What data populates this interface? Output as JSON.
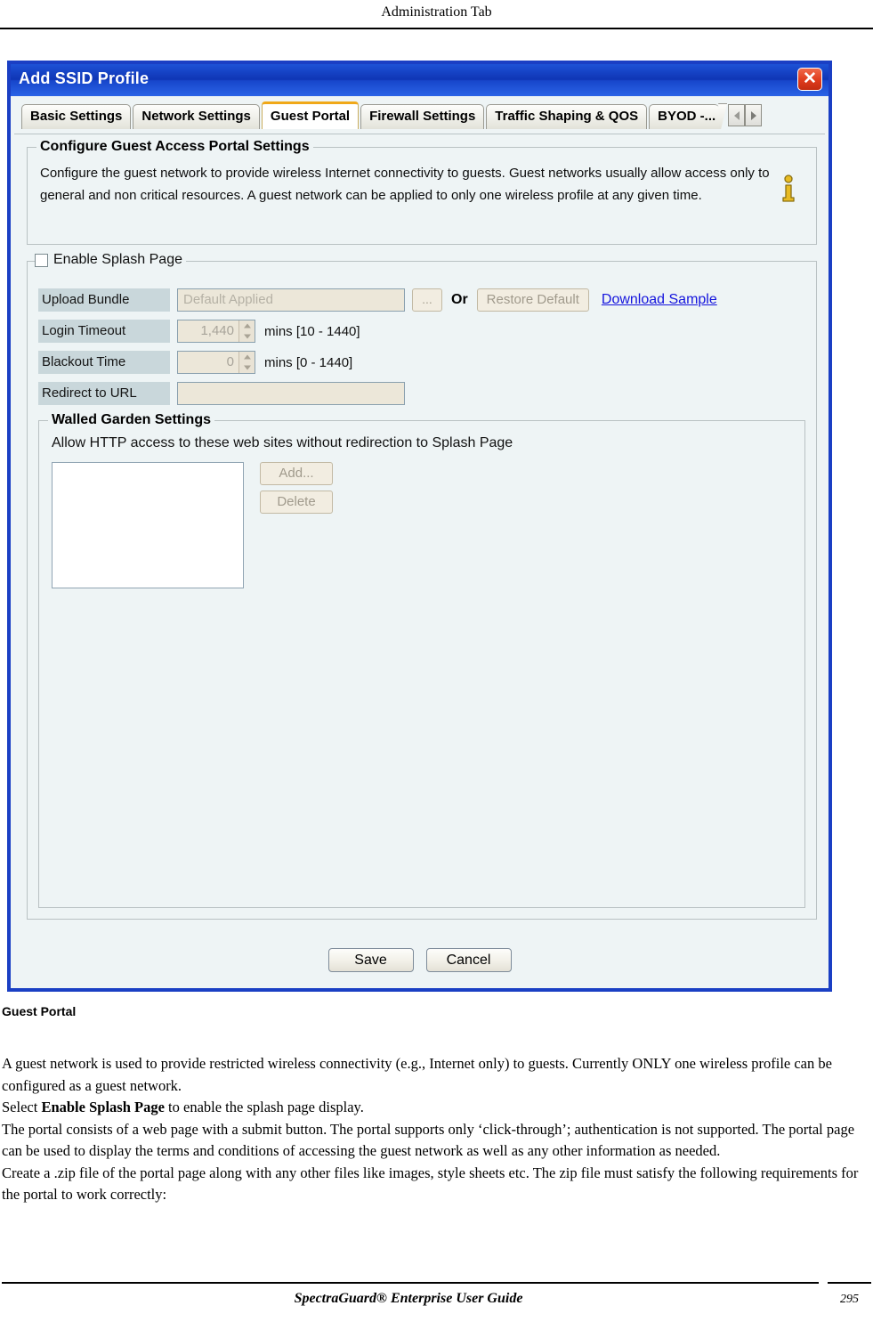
{
  "page": {
    "running_header": "Administration Tab",
    "footer_title": "SpectraGuard®  Enterprise User Guide",
    "page_number": "295",
    "figure_caption": "Guest Portal"
  },
  "dialog": {
    "title": "Add SSID Profile",
    "close_icon": "close-icon",
    "tabs": [
      {
        "label": "Basic Settings",
        "selected": false
      },
      {
        "label": "Network Settings",
        "selected": false
      },
      {
        "label": "Guest Portal",
        "selected": true
      },
      {
        "label": "Firewall Settings",
        "selected": false
      },
      {
        "label": "Traffic Shaping & QOS",
        "selected": false
      },
      {
        "label": "BYOD -...",
        "selected": false
      }
    ],
    "tab_scroll_left": "scroll-left-icon",
    "tab_scroll_right": "scroll-right-icon",
    "accent_selected_tab": "#f0a818",
    "titlebar_color": "#1746cb",
    "close_button_color": "#df3b1c"
  },
  "configure_group": {
    "title": "Configure Guest Access Portal Settings",
    "description": "Configure the guest network to provide wireless Internet connectivity to guests. Guest networks usually allow access only to general and non critical resources. A guest network can be applied to only one wireless profile at any given time.",
    "info_icon": "info-icon"
  },
  "splash_group": {
    "title": "Enable Splash Page",
    "checkbox_checked": false,
    "fields": {
      "upload_bundle": {
        "label": "Upload Bundle",
        "value": "",
        "placeholder": "Default Applied",
        "browse_button": "...",
        "or_text": "Or",
        "restore_default_button": "Restore Default",
        "download_sample_link": "Download Sample",
        "link_color": "#1414dd"
      },
      "login_timeout": {
        "label": "Login Timeout",
        "value": "1,440",
        "units": "mins [10 - 1440]"
      },
      "blackout_time": {
        "label": "Blackout Time",
        "value": "0",
        "units": "mins [0 - 1440]"
      },
      "redirect_url": {
        "label": "Redirect to URL",
        "value": "",
        "placeholder": ""
      }
    }
  },
  "walled_garden": {
    "title": "Walled Garden Settings",
    "description": "Allow HTTP access to these web sites without redirection to Splash Page",
    "list_items": [],
    "add_button": "Add...",
    "delete_button": "Delete"
  },
  "footer_buttons": {
    "save": "Save",
    "cancel": "Cancel"
  },
  "body_text": {
    "para1": "A guest network is used to provide restricted wireless connectivity (e.g., Internet only) to guests. Currently ONLY one wireless profile can be configured as a guest network.",
    "para2_prefix": "Select ",
    "para2_bold": "Enable Splash Page",
    "para2_suffix": "  to enable the splash page display.",
    "para3": "The portal consists of a web page with a submit button.  The portal supports only ‘click-through’; authentication is not supported. The portal page can be used to display the terms and conditions of accessing the guest network as well as any other information as needed.",
    "para4": "Create a .zip file of the portal page along with any other files like images, style sheets etc. The zip file must satisfy the following requirements for the portal to work correctly:"
  }
}
